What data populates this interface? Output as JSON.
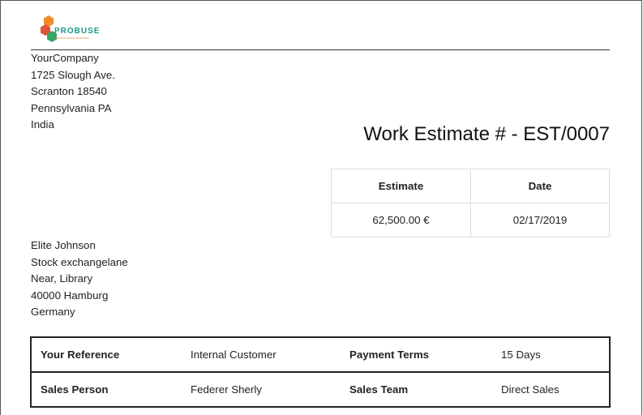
{
  "company_logo": {
    "name": "PROBUSE",
    "tagline": "PROFESSIONAL BUSINESS",
    "colors": {
      "orange": "#f08a2c",
      "red": "#e0523a",
      "green": "#35a862",
      "teal": "#1e9a8a"
    }
  },
  "company_address": [
    "YourCompany",
    "1725 Slough Ave.",
    "Scranton 18540",
    "Pennsylvania PA",
    "India"
  ],
  "document_title": "Work Estimate # - EST/0007",
  "estimate_table": {
    "headers": [
      "Estimate",
      "Date"
    ],
    "values": [
      "62,500.00 €",
      "02/17/2019"
    ]
  },
  "customer_address": [
    "Elite Johnson",
    "Stock exchangelane",
    "Near, Library",
    "40000 Hamburg",
    "Germany"
  ],
  "info_table": [
    [
      "Your Reference",
      "Internal Customer",
      "Payment Terms",
      "15 Days"
    ],
    [
      "Sales Person",
      "Federer Sherly",
      "Sales Team",
      "Direct Sales"
    ]
  ]
}
